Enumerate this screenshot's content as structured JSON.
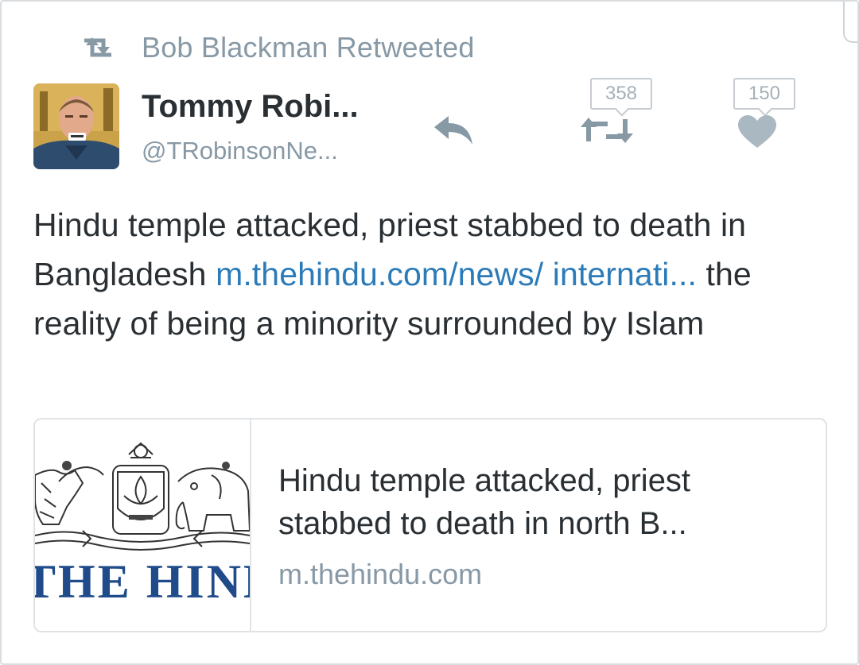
{
  "retweet_context": {
    "text": "Bob Blackman Retweeted",
    "icon": "retweet-icon"
  },
  "tweet": {
    "author_name": "Tommy Robi...",
    "author_handle": "@TRobinsonNe...",
    "avatar_icon": "avatar",
    "text_part1": "Hindu temple attacked, priest stabbed to death in Bangladesh ",
    "link_text": "m.thehindu.com/news/ internati...",
    "text_part2": " the reality of being a minority surrounded by Islam",
    "retweet_count": "358",
    "like_count": "150",
    "reply_icon": "reply-icon",
    "retweet_icon": "retweet-icon",
    "like_icon": "heart-icon"
  },
  "card": {
    "masthead": "THE HINDU",
    "title": "Hindu temple attacked, priest stabbed to death in north B...",
    "domain": "m.thehindu.com"
  },
  "colors": {
    "text": "#292f33",
    "muted": "#8899a6",
    "link": "#2b7bb9",
    "masthead": "#1f4b8a",
    "border": "#dfe3e6"
  }
}
